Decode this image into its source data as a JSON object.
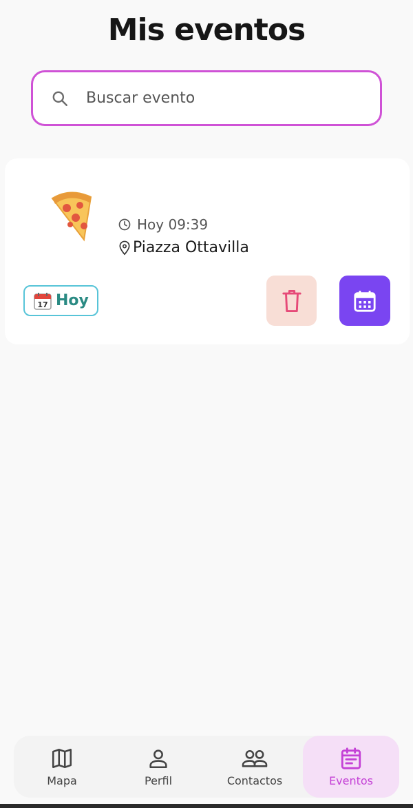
{
  "header": {
    "title": "Mis eventos"
  },
  "search": {
    "placeholder": "Buscar evento",
    "icon": "search-icon"
  },
  "events": [
    {
      "emoji": "🍕",
      "time": "Hoy 09:39",
      "place": "Piazza Ottavilla",
      "date_chip": {
        "icon": "calendar-emoji-icon",
        "label": "Hoy"
      }
    }
  ],
  "nav": {
    "items": [
      {
        "label": "Mapa",
        "icon": "map-icon"
      },
      {
        "label": "Perfil",
        "icon": "person-icon"
      },
      {
        "label": "Contactos",
        "icon": "group-icon"
      },
      {
        "label": "Eventos",
        "icon": "event-note-icon",
        "active": true
      }
    ]
  },
  "colors": {
    "accent": "#cf52d6",
    "delete_bg": "#f8ded6",
    "delete_icon": "#e64a78",
    "calendar_btn": "#7a45f1",
    "chip_border": "#57c4d8",
    "chip_text": "#2a8a83",
    "nav_active_bg": "#f5dff7"
  }
}
